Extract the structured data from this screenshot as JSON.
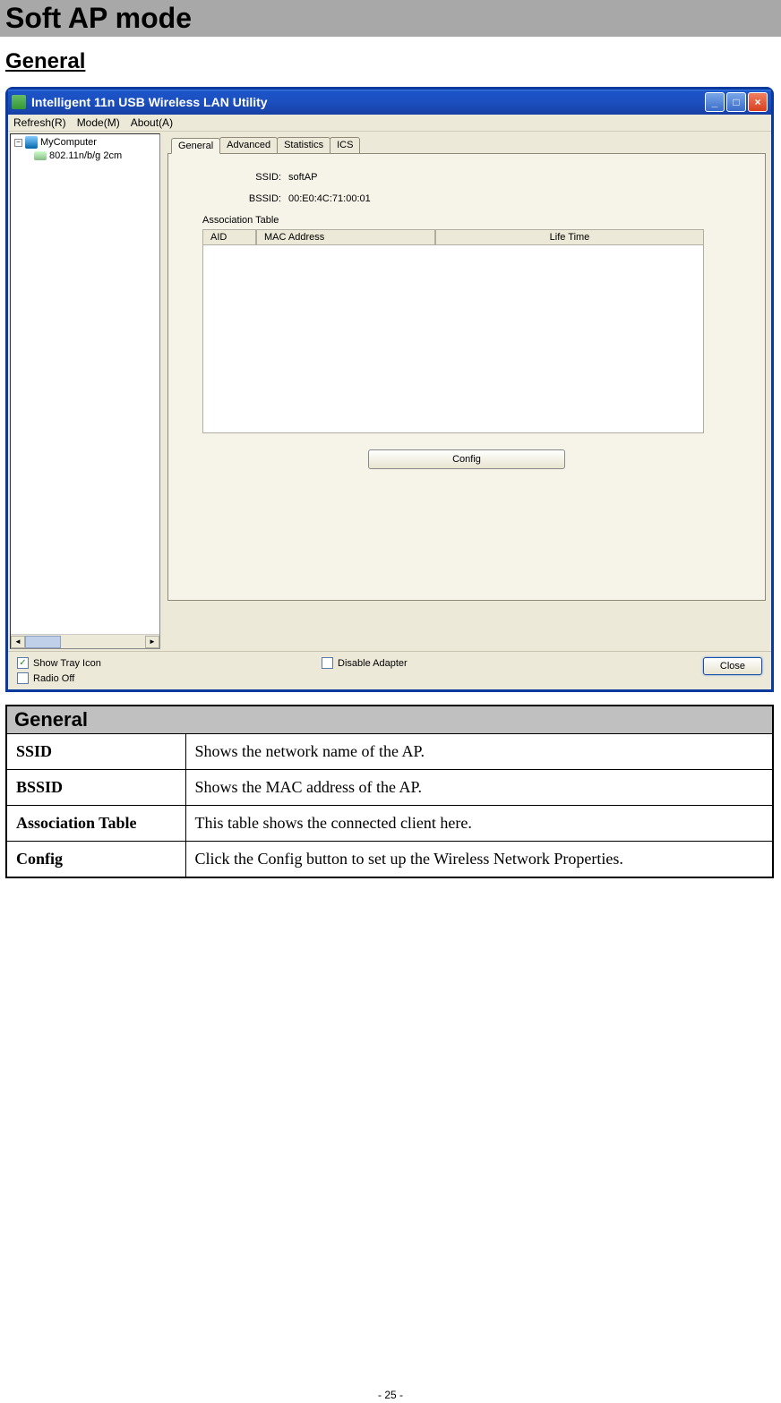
{
  "page": {
    "title": "Soft AP mode",
    "heading": "General",
    "footer": "- 25 -"
  },
  "window": {
    "title": "Intelligent 11n USB Wireless LAN Utility",
    "menu": {
      "refresh": "Refresh(R)",
      "mode": "Mode(M)",
      "about": "About(A)"
    },
    "tree": {
      "root": "MyComputer",
      "child": "802.11n/b/g 2cm"
    },
    "tabs": {
      "general": "General",
      "advanced": "Advanced",
      "statistics": "Statistics",
      "ics": "ICS"
    },
    "fields": {
      "ssid_label": "SSID:",
      "ssid_value": "softAP",
      "bssid_label": "BSSID:",
      "bssid_value": "00:E0:4C:71:00:01"
    },
    "assoc": {
      "label": "Association Table",
      "col_aid": "AID",
      "col_mac": "MAC Address",
      "col_life": "Life Time"
    },
    "buttons": {
      "config": "Config",
      "close": "Close"
    },
    "checkboxes": {
      "show_tray": "Show Tray Icon",
      "radio_off": "Radio Off",
      "disable_adapter": "Disable Adapter"
    }
  },
  "ref_table": {
    "title": "General",
    "rows": [
      {
        "term": "SSID",
        "desc": "Shows the network name of the AP."
      },
      {
        "term": "BSSID",
        "desc": "Shows the MAC address of the AP."
      },
      {
        "term": "Association Table",
        "desc": "This table shows the connected client here."
      },
      {
        "term": "Config",
        "desc": "Click the Config button to set up the Wireless Network Properties."
      }
    ]
  }
}
